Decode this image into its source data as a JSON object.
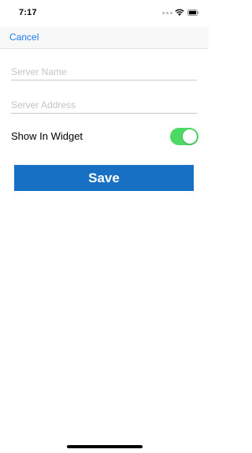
{
  "status_bar": {
    "time": "7:17"
  },
  "nav": {
    "cancel_label": "Cancel"
  },
  "form": {
    "server_name": {
      "value": "",
      "placeholder": "Server Name"
    },
    "server_address": {
      "value": "",
      "placeholder": "Server Address"
    },
    "show_in_widget": {
      "label": "Show In Widget",
      "on": true
    },
    "save_label": "Save"
  },
  "colors": {
    "accent": "#1a7cf0",
    "save_button": "#1770c4",
    "toggle_on": "#4cd964"
  }
}
